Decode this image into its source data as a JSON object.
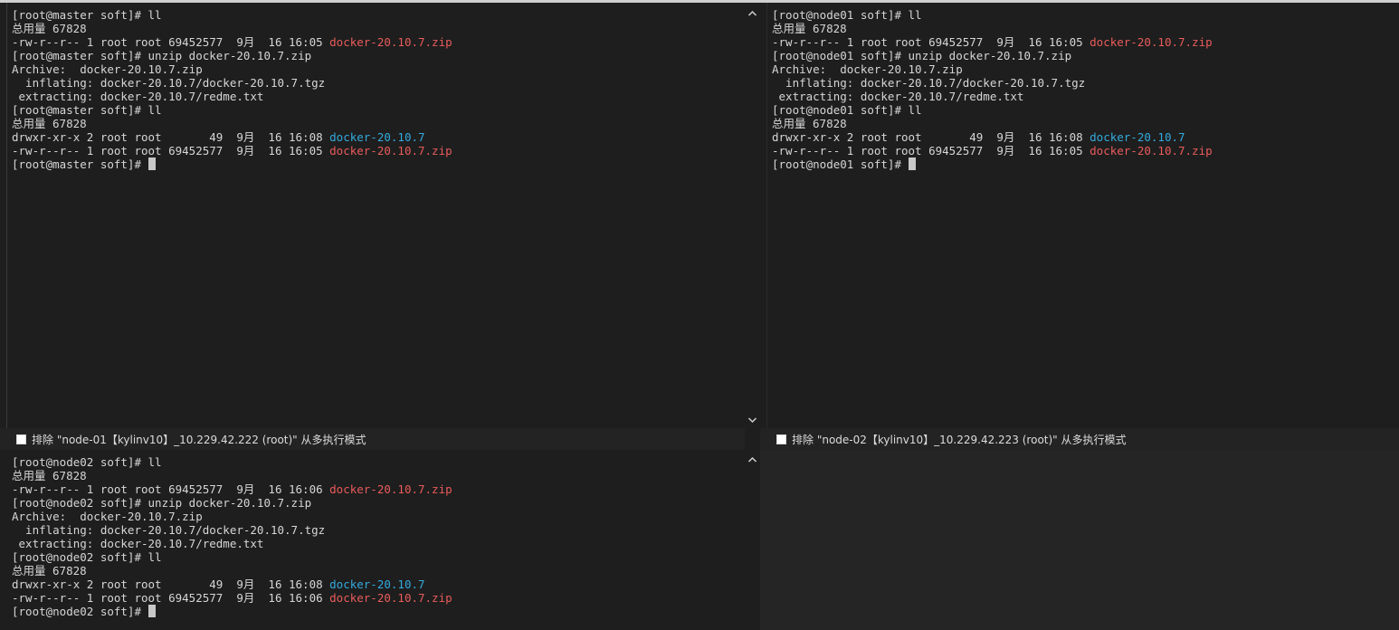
{
  "panes": {
    "master": {
      "lines": [
        [
          {
            "t": "[root@master soft]# ll"
          }
        ],
        [
          {
            "t": "总用量 67828"
          }
        ],
        [
          {
            "t": "-rw-r--r-- 1 root root 69452577  9月  16 16:05 "
          },
          {
            "t": "docker-20.10.7.zip",
            "c": "red"
          }
        ],
        [
          {
            "t": "[root@master soft]# unzip docker-20.10.7.zip"
          }
        ],
        [
          {
            "t": "Archive:  docker-20.10.7.zip"
          }
        ],
        [
          {
            "t": "  inflating: docker-20.10.7/docker-20.10.7.tgz"
          }
        ],
        [
          {
            "t": " extracting: docker-20.10.7/redme.txt"
          }
        ],
        [
          {
            "t": "[root@master soft]# ll"
          }
        ],
        [
          {
            "t": "总用量 67828"
          }
        ],
        [
          {
            "t": "drwxr-xr-x 2 root root       49  9月  16 16:08 "
          },
          {
            "t": "docker-20.10.7",
            "c": "blue"
          }
        ],
        [
          {
            "t": "-rw-r--r-- 1 root root 69452577  9月  16 16:05 "
          },
          {
            "t": "docker-20.10.7.zip",
            "c": "red"
          }
        ],
        [
          {
            "t": "[root@master soft]# "
          },
          {
            "cursor": true
          }
        ]
      ]
    },
    "node01": {
      "lines": [
        [
          {
            "t": "[root@node01 soft]# ll"
          }
        ],
        [
          {
            "t": "总用量 67828"
          }
        ],
        [
          {
            "t": "-rw-r--r-- 1 root root 69452577  9月  16 16:05 "
          },
          {
            "t": "docker-20.10.7.zip",
            "c": "red"
          }
        ],
        [
          {
            "t": "[root@node01 soft]# unzip docker-20.10.7.zip"
          }
        ],
        [
          {
            "t": "Archive:  docker-20.10.7.zip"
          }
        ],
        [
          {
            "t": "  inflating: docker-20.10.7/docker-20.10.7.tgz"
          }
        ],
        [
          {
            "t": " extracting: docker-20.10.7/redme.txt"
          }
        ],
        [
          {
            "t": "[root@node01 soft]# ll"
          }
        ],
        [
          {
            "t": "总用量 67828"
          }
        ],
        [
          {
            "t": "drwxr-xr-x 2 root root       49  9月  16 16:08 "
          },
          {
            "t": "docker-20.10.7",
            "c": "blue"
          }
        ],
        [
          {
            "t": "-rw-r--r-- 1 root root 69452577  9月  16 16:05 "
          },
          {
            "t": "docker-20.10.7.zip",
            "c": "red"
          }
        ],
        [
          {
            "t": "[root@node01 soft]# "
          },
          {
            "cursor": true
          }
        ]
      ]
    },
    "node02": {
      "lines": [
        [
          {
            "t": "[root@node02 soft]# ll"
          }
        ],
        [
          {
            "t": "总用量 67828"
          }
        ],
        [
          {
            "t": "-rw-r--r-- 1 root root 69452577  9月  16 16:06 "
          },
          {
            "t": "docker-20.10.7.zip",
            "c": "red"
          }
        ],
        [
          {
            "t": "[root@node02 soft]# unzip docker-20.10.7.zip"
          }
        ],
        [
          {
            "t": "Archive:  docker-20.10.7.zip"
          }
        ],
        [
          {
            "t": "  inflating: docker-20.10.7/docker-20.10.7.tgz"
          }
        ],
        [
          {
            "t": " extracting: docker-20.10.7/redme.txt"
          }
        ],
        [
          {
            "t": "[root@node02 soft]# ll"
          }
        ],
        [
          {
            "t": "总用量 67828"
          }
        ],
        [
          {
            "t": "drwxr-xr-x 2 root root       49  9月  16 16:08 "
          },
          {
            "t": "docker-20.10.7",
            "c": "blue"
          }
        ],
        [
          {
            "t": "-rw-r--r-- 1 root root 69452577  9月  16 16:06 "
          },
          {
            "t": "docker-20.10.7.zip",
            "c": "red"
          }
        ],
        [
          {
            "t": "[root@node02 soft]# "
          },
          {
            "cursor": true
          }
        ]
      ]
    }
  },
  "status_bars": {
    "left": {
      "label": "排除 \"node-01【kylinv10】_10.229.42.222 (root)\" 从多执行模式"
    },
    "right": {
      "label": "排除 \"node-02【kylinv10】_10.229.42.223 (root)\" 从多执行模式"
    }
  },
  "icons": {
    "scroll_up": "chevron-up-icon",
    "scroll_down": "chevron-down-icon",
    "checkbox": "checkbox-icon"
  },
  "colors": {
    "background": "#1e1e1e",
    "text": "#d6d6d6",
    "zip_file": "#ea5b5b",
    "directory": "#33aadd"
  }
}
